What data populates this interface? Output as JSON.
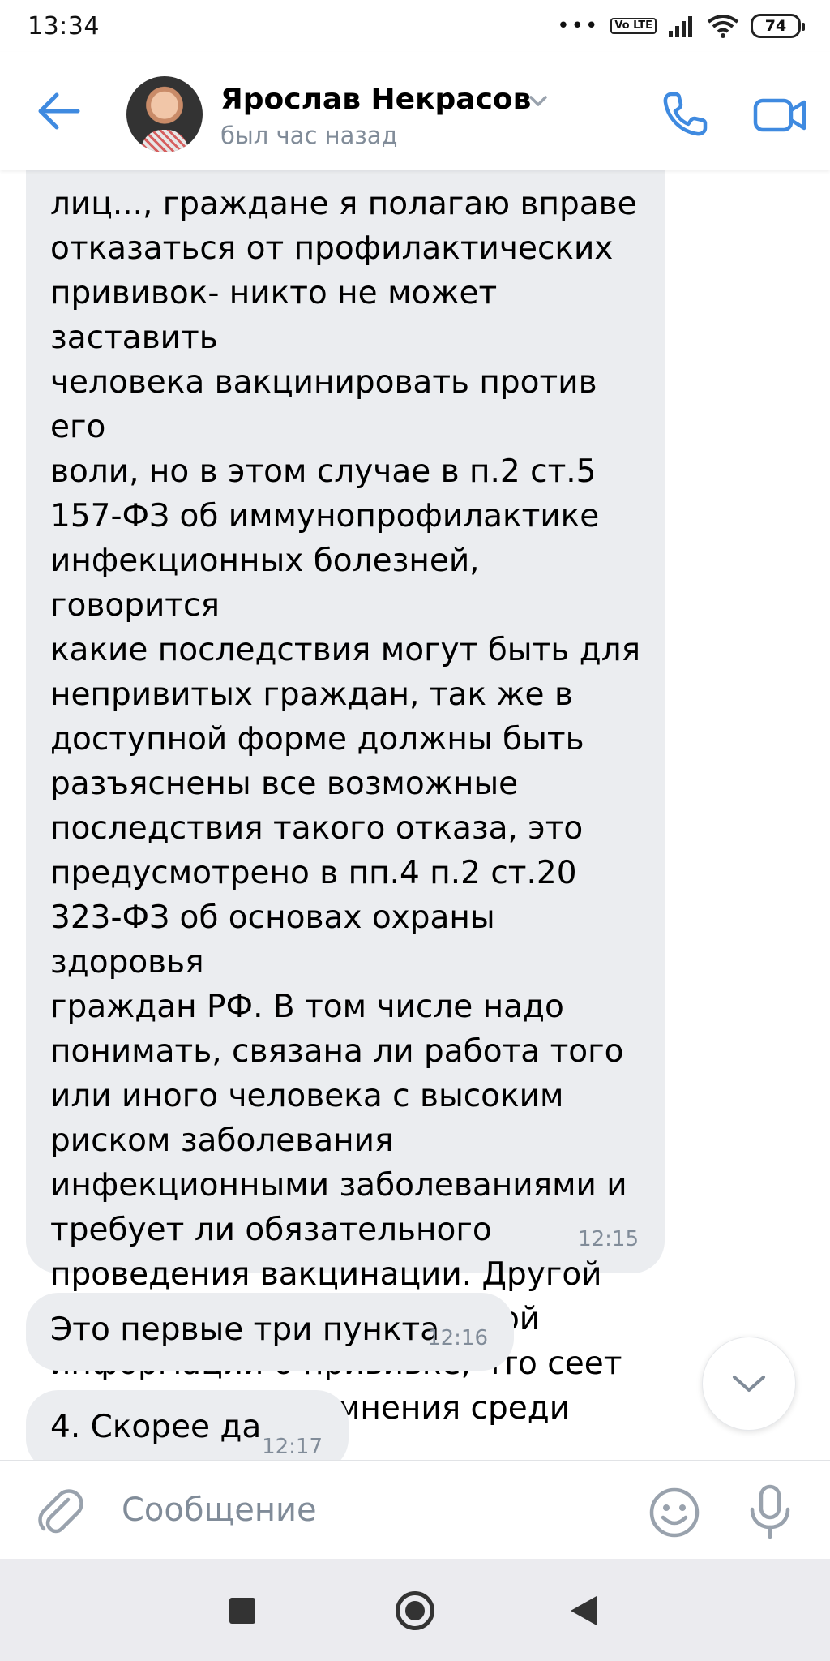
{
  "status_bar": {
    "time": "13:34",
    "network_badge": "Vo LTE",
    "battery": "74"
  },
  "header": {
    "contact_name": "Ярослав Некрасов",
    "contact_status": "был час назад"
  },
  "messages": [
    {
      "text": "лиц..., граждане я полагаю вправе\nотказаться от профилактических\nпрививок- никто не может заставить\nчеловека вакцинировать против его\nволи, но в этом случае в п.2 ст.5\n157-ФЗ об иммунопрофилактике\nинфекционных болезней, говорится\nкакие последствия могут быть для\nнепривитых граждан, так же в\nдоступной форме должны быть\nразъяснены все возможные\nпоследствия такого отказа, это\nпредусмотрено в пп.4 п.2 ст.20\n323-ФЗ об основах охраны здоровья\nграждан РФ. В том числе надо\nпонимать, связана ли работа того\nили иного человека с высоким\nриском заболевания\nинфекционными заболеваниями и\nтребует ли обязательного\nпроведения вакцинации. Другой\nвопрос это отсутсвие полной\nинформации о прививке, что сеет\nобоснованные сомнения среди\nнаселения.",
      "time": "12:15"
    },
    {
      "text": "Это первые три пункта",
      "time": "12:16"
    },
    {
      "text": "4. Скорее да",
      "time": "12:17"
    }
  ],
  "composer": {
    "placeholder": "Сообщение"
  },
  "colors": {
    "accent": "#3f8ae0",
    "bubble": "#ebedf0",
    "secondary_text": "#818c99"
  },
  "icons": [
    "back-arrow-icon",
    "chevron-down-icon",
    "phone-icon",
    "video-camera-icon",
    "paperclip-icon",
    "emoji-icon",
    "microphone-icon",
    "scroll-down-icon"
  ]
}
